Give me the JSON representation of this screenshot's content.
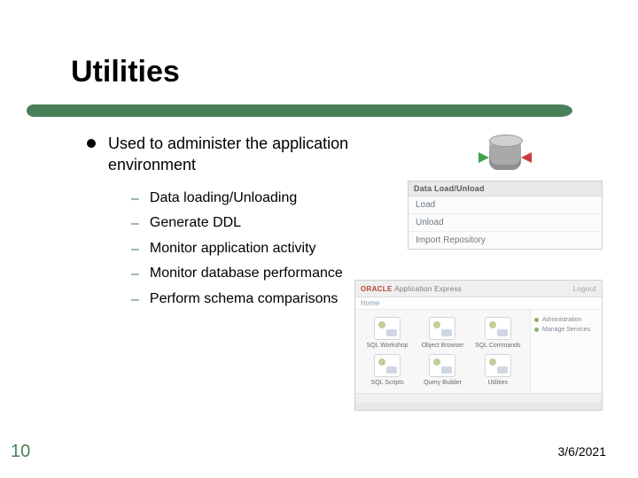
{
  "title": "Utilities",
  "accent_color": "#4b7f59",
  "bullets": {
    "level1": "Used to administer the application environment",
    "level2": [
      "Data loading/Unloading",
      "Generate DDL",
      "Monitor application activity",
      "Monitor database performance",
      "Perform schema comparisons"
    ]
  },
  "fig_top": {
    "panel_header": "Data Load/Unload",
    "rows": [
      "Load",
      "Unload",
      "Import Repository"
    ]
  },
  "fig_bot": {
    "brand": "ORACLE",
    "brand_sub": "Application Express",
    "bar_right": "Logout",
    "breadcrumb": "Home",
    "tiles": [
      "SQL Workshop",
      "Object Browser",
      "SQL Commands",
      "SQL Scripts",
      "Query Builder",
      "Utilities"
    ],
    "side_links": [
      "Administration",
      "Manage Services"
    ]
  },
  "page_number": "10",
  "date": "3/6/2021"
}
